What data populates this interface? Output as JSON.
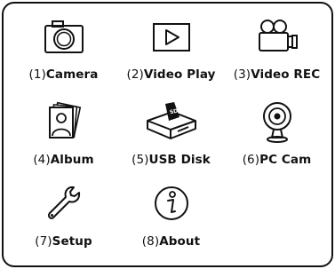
{
  "menu": {
    "items": [
      {
        "num": "(1)",
        "label": "Camera",
        "icon": "camera-icon"
      },
      {
        "num": "(2)",
        "label": "Video Play",
        "icon": "video-play-icon"
      },
      {
        "num": "(3)",
        "label": "Video REC",
        "icon": "video-camera-icon"
      },
      {
        "num": "(4)",
        "label": "Album",
        "icon": "album-photos-icon"
      },
      {
        "num": "(5)",
        "label": "USB Disk",
        "icon": "usb-disk-sd-icon"
      },
      {
        "num": "(6)",
        "label": "PC Cam",
        "icon": "webcam-icon"
      },
      {
        "num": "(7)",
        "label": "Setup",
        "icon": "wrench-icon"
      },
      {
        "num": "(8)",
        "label": "About",
        "icon": "info-icon"
      }
    ]
  }
}
